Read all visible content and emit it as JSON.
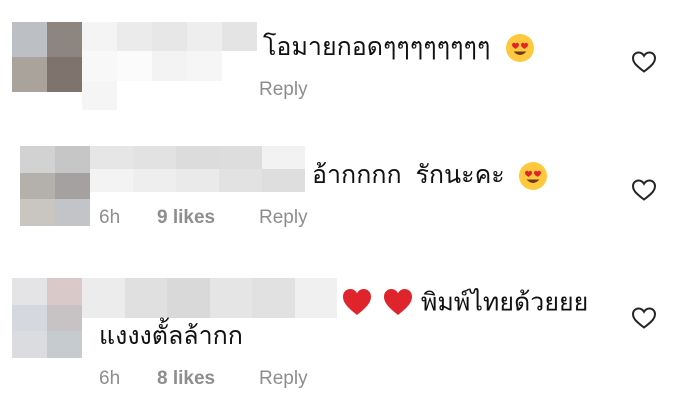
{
  "comments": [
    {
      "text": "โอมายกอดๆๆๆๆๆๆๆๆ",
      "emojis": [
        "heart-eyes"
      ],
      "time": "",
      "likes": "",
      "reply": "Reply"
    },
    {
      "text": "อ้ากกกก  รักนะคะ",
      "emojis": [
        "heart-eyes"
      ],
      "time": "6h",
      "likes": "9 likes",
      "reply": "Reply"
    },
    {
      "text_prefix_emojis": [
        "red-heart",
        "red-heart"
      ],
      "text": "พิมพ์ไทยด้วยยย",
      "text_line2": "แงงงตั้ลล้ากก",
      "time": "6h",
      "likes": "8 likes",
      "reply": "Reply"
    }
  ],
  "colors": {
    "meta": "#8e8e8e",
    "text": "#111111",
    "heart": "#e0242c",
    "emoji_face": "#ffc83d"
  },
  "icons": [
    "like-heart-outline-icon",
    "heart-eyes-emoji",
    "red-heart-emoji"
  ]
}
